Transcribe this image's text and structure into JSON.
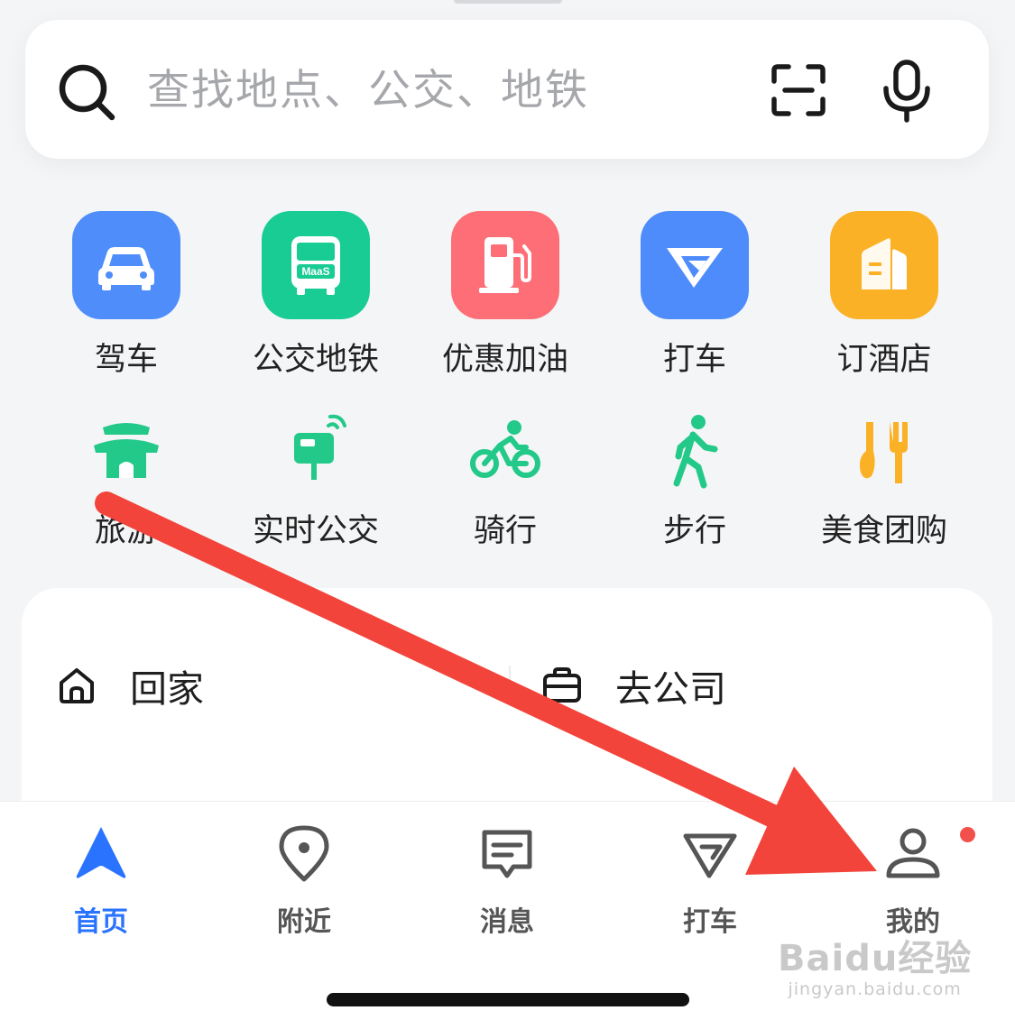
{
  "search": {
    "placeholder": "查找地点、公交、地铁",
    "icons": [
      "search-icon",
      "scan-icon",
      "microphone-icon"
    ]
  },
  "services_row1": [
    {
      "label": "驾车",
      "icon": "car-icon",
      "color": "#4f8dfb"
    },
    {
      "label": "公交地铁",
      "icon": "bus-maas-icon",
      "icon_text": "MaaS",
      "color": "#19cc94"
    },
    {
      "label": "优惠加油",
      "icon": "fuel-pump-icon",
      "color": "#fd6e76"
    },
    {
      "label": "打车",
      "icon": "taxi-icon",
      "color": "#4e8cfb"
    },
    {
      "label": "订酒店",
      "icon": "hotel-icon",
      "color": "#fbb125"
    }
  ],
  "services_row2": [
    {
      "label": "旅游",
      "icon": "pagoda-icon",
      "color": "#23c988"
    },
    {
      "label": "实时公交",
      "icon": "realtime-bus-icon",
      "color": "#23c988"
    },
    {
      "label": "骑行",
      "icon": "cycling-icon",
      "color": "#23c988"
    },
    {
      "label": "步行",
      "icon": "walking-icon",
      "color": "#23c988"
    },
    {
      "label": "美食团购",
      "icon": "food-icon",
      "color": "#fbb125"
    }
  ],
  "shortcuts": {
    "home": "回家",
    "company": "去公司"
  },
  "tabs": [
    {
      "label": "首页",
      "icon": "navigation-icon",
      "active": true
    },
    {
      "label": "附近",
      "icon": "location-pin-icon",
      "active": false
    },
    {
      "label": "消息",
      "icon": "message-icon",
      "active": false
    },
    {
      "label": "打车",
      "icon": "taxi-icon",
      "active": false
    },
    {
      "label": "我的",
      "icon": "user-icon",
      "active": false,
      "badge": "red-dot"
    }
  ],
  "colors": {
    "accent": "#2a73ff",
    "annotation_arrow": "#f2443a",
    "badge": "#f2504b"
  },
  "watermark": {
    "logo": "Baidu经验",
    "url": "jingyan.baidu.com"
  }
}
